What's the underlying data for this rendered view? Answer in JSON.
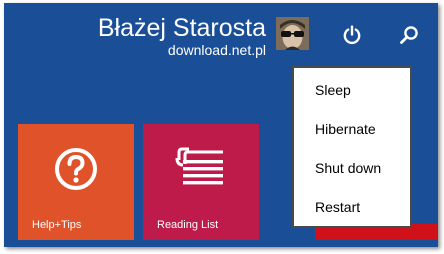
{
  "user": {
    "name": "Błażej Starosta",
    "subtitle": "download.net.pl"
  },
  "header_buttons": {
    "power_icon": "power-icon",
    "search_icon": "search-icon"
  },
  "tiles": [
    {
      "label": "Help+Tips",
      "icon": "question-circle-icon",
      "color": "#e0522a"
    },
    {
      "label": "Reading List",
      "icon": "reading-list-icon",
      "color": "#be1b4b"
    }
  ],
  "power_menu": {
    "items": [
      "Sleep",
      "Hibernate",
      "Shut down",
      "Restart"
    ]
  },
  "colors": {
    "background": "#1a4e97",
    "menu_background": "#ffffff",
    "partial_tile": "#d1111a"
  }
}
